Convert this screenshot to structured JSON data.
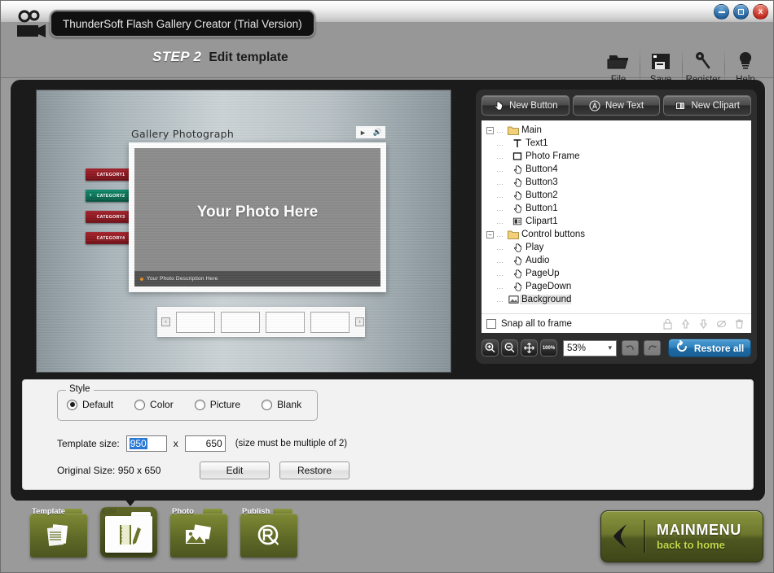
{
  "window": {
    "title": "ThunderSoft Flash Gallery Creator (Trial Version)",
    "minimize_label": "–",
    "maximize_label": "□",
    "close_label": "x"
  },
  "header": {
    "step_number": "STEP 2",
    "step_title": "Edit template",
    "app_icon": "video-camera-icon",
    "toolbar": [
      {
        "label": "File",
        "icon": "folder-icon"
      },
      {
        "label": "Save",
        "icon": "floppy-disk-icon"
      },
      {
        "label": "Register",
        "icon": "key-icon"
      },
      {
        "label": "Help",
        "icon": "lightbulb-icon"
      }
    ]
  },
  "preview": {
    "gallery_title": "Gallery Photograph",
    "play_icon": "play-icon",
    "audio_icon": "speaker-icon",
    "categories": [
      {
        "label": "CATEGORY1",
        "active": false
      },
      {
        "label": "CATEGORY2",
        "active": true
      },
      {
        "label": "CATEGORY3",
        "active": false
      },
      {
        "label": "CATEGORY4",
        "active": false
      }
    ],
    "photo_placeholder": "Your Photo Here",
    "photo_description": "Your Photo Description Here",
    "thumb_prev": "‹",
    "thumb_next": "›",
    "thumbnail_count": 4
  },
  "side": {
    "buttons": [
      {
        "label": "New Button",
        "icon": "hand-pointer-icon"
      },
      {
        "label": "New Text",
        "icon": "text-circle-icon"
      },
      {
        "label": "New Clipart",
        "icon": "clipart-icon"
      }
    ],
    "tree": [
      {
        "label": "Main",
        "depth": 0,
        "icon": "folder-icon",
        "toggle": "−",
        "selected": false
      },
      {
        "label": "Text1",
        "depth": 1,
        "icon": "text-icon",
        "toggle": "",
        "selected": false
      },
      {
        "label": "Photo Frame",
        "depth": 1,
        "icon": "frame-icon",
        "toggle": "",
        "selected": false
      },
      {
        "label": "Button4",
        "depth": 1,
        "icon": "hand-pointer-icon",
        "toggle": "",
        "selected": false
      },
      {
        "label": "Button3",
        "depth": 1,
        "icon": "hand-pointer-icon",
        "toggle": "",
        "selected": false
      },
      {
        "label": "Button2",
        "depth": 1,
        "icon": "hand-pointer-icon",
        "toggle": "",
        "selected": false
      },
      {
        "label": "Button1",
        "depth": 1,
        "icon": "hand-pointer-icon",
        "toggle": "",
        "selected": false
      },
      {
        "label": "Clipart1",
        "depth": 1,
        "icon": "clipart-icon",
        "toggle": "",
        "selected": false
      },
      {
        "label": "Control buttons",
        "depth": 0,
        "icon": "folder-icon",
        "toggle": "−",
        "selected": false
      },
      {
        "label": "Play",
        "depth": 1,
        "icon": "hand-pointer-icon",
        "toggle": "",
        "selected": false
      },
      {
        "label": "Audio",
        "depth": 1,
        "icon": "hand-pointer-icon",
        "toggle": "",
        "selected": false
      },
      {
        "label": "PageUp",
        "depth": 1,
        "icon": "hand-pointer-icon",
        "toggle": "",
        "selected": false
      },
      {
        "label": "PageDown",
        "depth": 1,
        "icon": "hand-pointer-icon",
        "toggle": "",
        "selected": false
      },
      {
        "label": "Background",
        "depth": 0,
        "icon": "image-icon",
        "toggle": "",
        "selected": true
      }
    ],
    "snap_label": "Snap all to frame",
    "snap_checked": false,
    "align_icons": [
      "lock-icon",
      "arrow-up-icon",
      "arrow-down-icon",
      "merge-icon",
      "trash-icon"
    ],
    "zoom_in_icon": "zoom-in-icon",
    "zoom_out_icon": "zoom-out-icon",
    "zoom_fit_icon": "move-fit-icon",
    "zoom_100_label": "100%",
    "zoom_value": "53%",
    "undo_icon": "undo-icon",
    "redo_icon": "redo-icon",
    "restore_all_label": "Restore all",
    "restore_all_icon": "restore-icon",
    "restore_all_color": "#2f7fbb"
  },
  "style": {
    "legend": "Style",
    "options": [
      {
        "label": "Default",
        "selected": true
      },
      {
        "label": "Color",
        "selected": false
      },
      {
        "label": "Picture",
        "selected": false
      },
      {
        "label": "Blank",
        "selected": false
      }
    ],
    "template_size_label": "Template size:",
    "width_value": "950",
    "height_value": "650",
    "separator": "x",
    "hint": "(size must be multiple of 2)",
    "original_size": "Original Size: 950 x 650",
    "edit_label": "Edit",
    "restore_label": "Restore"
  },
  "bottom": {
    "steps": [
      {
        "label": "Template",
        "icon": "documents-icon",
        "active": false
      },
      {
        "label": "Edit",
        "icon": "notebook-pencil-icon",
        "active": true
      },
      {
        "label": "Photo",
        "icon": "photos-icon",
        "active": false
      },
      {
        "label": "Publish",
        "icon": "publish-icon",
        "active": false
      }
    ],
    "mainmenu_title": "MAINMENU",
    "mainmenu_subtitle": "back to home",
    "mainmenu_icon": "back-arrow-icon"
  }
}
